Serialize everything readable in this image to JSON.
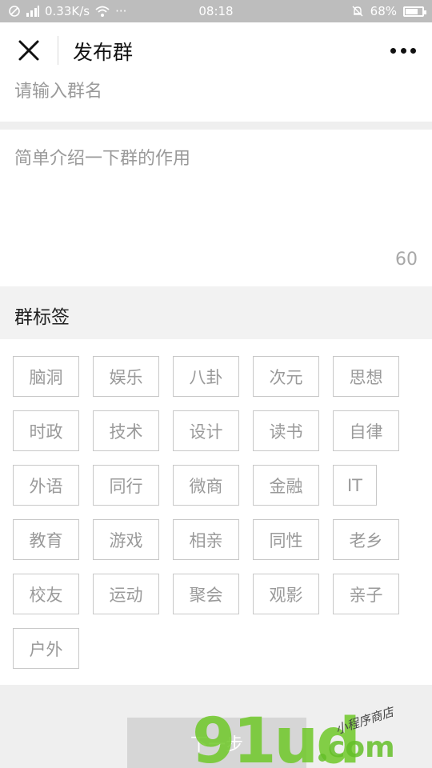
{
  "status_bar": {
    "network_speed": "0.33K/s",
    "time": "08:18",
    "battery_percent": "68%",
    "battery_level": 0.68,
    "icons": [
      "no-sim-icon",
      "signal-icon",
      "wifi-icon",
      "more-dots-icon",
      "mute-icon",
      "battery-icon"
    ]
  },
  "header": {
    "title": "发布群",
    "close_icon": "close-icon",
    "more_icon": "more-icon"
  },
  "form": {
    "name_placeholder": "请输入群名",
    "name_value": "",
    "intro_placeholder": "简单介绍一下群的作用",
    "intro_value": "",
    "char_count": "60"
  },
  "tags": {
    "label": "群标签",
    "items": [
      "脑洞",
      "娱乐",
      "八卦",
      "次元",
      "思想",
      "时政",
      "技术",
      "设计",
      "读书",
      "自律",
      "外语",
      "同行",
      "微商",
      "金融",
      "IT",
      "教育",
      "游戏",
      "相亲",
      "同性",
      "老乡",
      "校友",
      "运动",
      "聚会",
      "观影",
      "亲子",
      "户外"
    ]
  },
  "actions": {
    "next_label": "下一步"
  },
  "watermark": {
    "main": "91ud",
    "sub": "com",
    "script": "小程序商店"
  },
  "colors": {
    "status_bar_bg": "#bdbdbd",
    "tag_border": "#c8c8c8",
    "tag_text": "#9a9a9a",
    "button_disabled": "#d6d6d6",
    "watermark_green": "#6ec828"
  }
}
